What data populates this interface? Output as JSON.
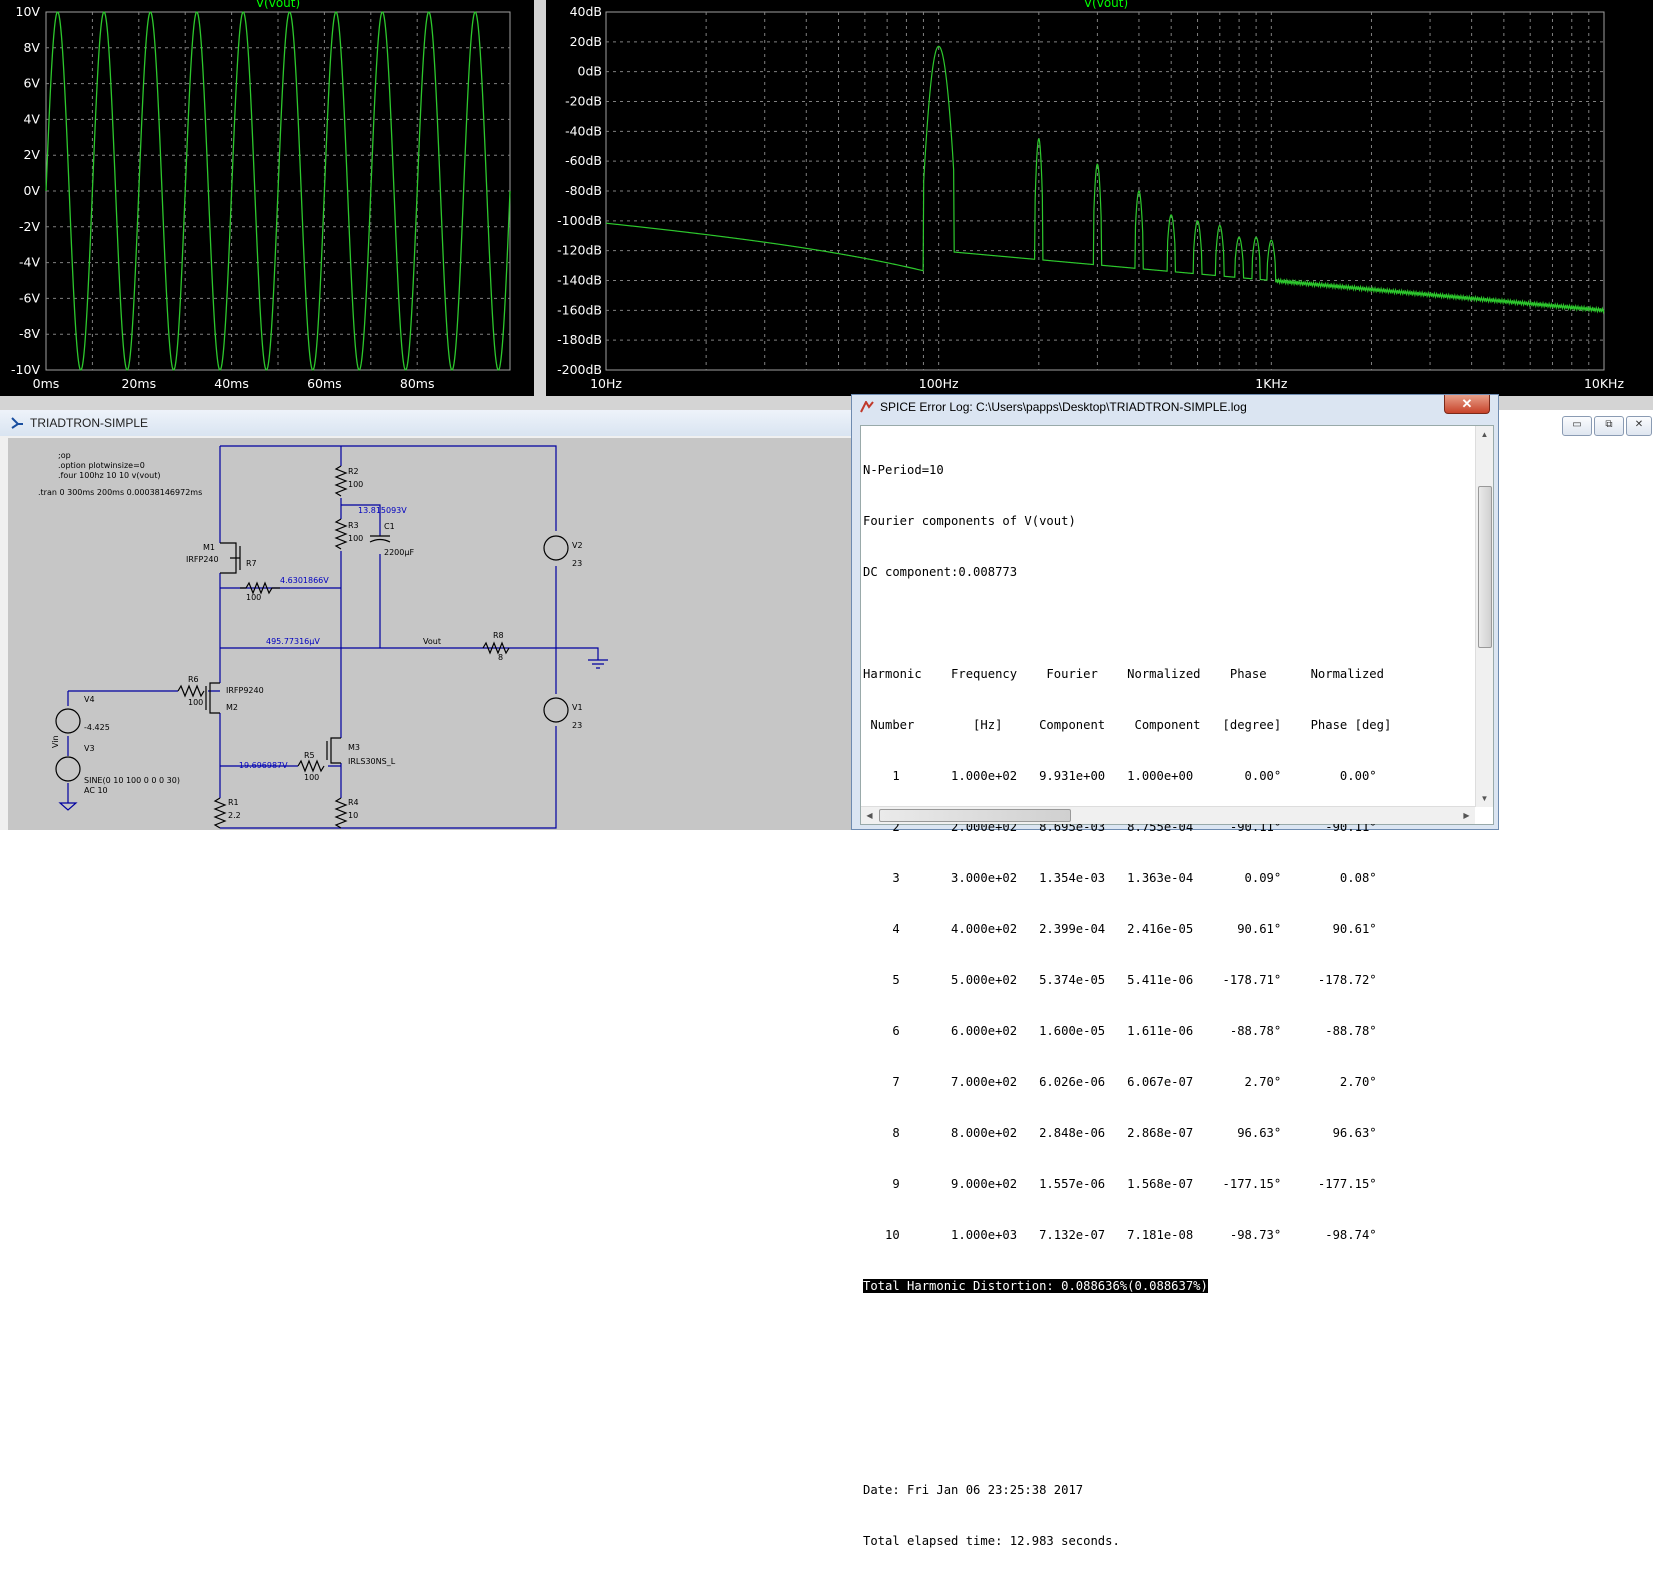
{
  "transient_plot": {
    "title": "V(vout)",
    "y_ticks": [
      "10V",
      "8V",
      "6V",
      "4V",
      "2V",
      "0V",
      "-2V",
      "-4V",
      "-6V",
      "-8V",
      "-10V"
    ],
    "x_ticks": [
      "0ms",
      "20ms",
      "40ms",
      "60ms",
      "80ms"
    ],
    "trace_color": "#2dc82d",
    "grid": true,
    "chart_data": {
      "type": "line",
      "series": [
        {
          "name": "V(vout)",
          "frequency_hz": 100,
          "amplitude_v": 10
        }
      ],
      "xlim": [
        0,
        100
      ],
      "ylim": [
        -10,
        10
      ]
    }
  },
  "fft_plot": {
    "title": "V(vout)",
    "y_ticks": [
      "40dB",
      "20dB",
      "0dB",
      "-20dB",
      "-40dB",
      "-60dB",
      "-80dB",
      "-100dB",
      "-120dB",
      "-140dB",
      "-160dB",
      "-180dB",
      "-200dB"
    ],
    "x_ticks": [
      "10Hz",
      "100Hz",
      "1KHz",
      "10KHz"
    ],
    "x_scale": "log",
    "chart_data": {
      "type": "line",
      "x_hz": [
        10,
        90,
        100,
        110,
        200,
        300,
        400,
        500,
        600,
        700,
        800,
        900,
        1000,
        10000
      ],
      "y_db": [
        -100,
        -118,
        17,
        -118,
        -45,
        -62,
        -80,
        -96,
        -100,
        -103,
        -111,
        -111,
        -113,
        -160
      ],
      "ylim": [
        -200,
        40
      ],
      "xlim": [
        10,
        10000
      ]
    }
  },
  "schematic": {
    "window_title": "TRIADTRON-SIMPLE",
    "directives": [
      ";op",
      ".option plotwinsize=0",
      ".four 100hz 10 10 v(vout)"
    ],
    "tran": ".tran 0 300ms 200ms 0.00038146972ms",
    "labels": {
      "r2": "R2",
      "r2v": "100",
      "r3": "R3",
      "r3v": "100",
      "node1": "13.815093V",
      "c1": "C1",
      "c1v": "2200µF",
      "m1": "M1",
      "m1v": "IRFP240",
      "r7": "R7",
      "r7v": "100",
      "node2": "4.6301866V",
      "v2": "V2",
      "v2v": "23",
      "node3": "495.77316µV",
      "vout": "Vout",
      "r8": "R8",
      "r8v": "8",
      "r6": "R6",
      "r6v": "100",
      "m2v": "IRFP9240",
      "m2": "M2",
      "v4": "V4",
      "v4v": "-4.425",
      "vin": "Vin",
      "v3": "V3",
      "v3v": "SINE(0 10 100 0 0 0 30)",
      "v3ac": "AC 10",
      "v1": "V1",
      "v1v": "23",
      "node4": "-19.696987V",
      "r5": "R5",
      "r5v": "100",
      "m3": "M3",
      "m3v": "IRLS30NS_L",
      "r1": "R1",
      "r1v": "2.2",
      "r4": "R4",
      "r4v": "10"
    }
  },
  "window_controls": {
    "minimize": "▭",
    "restore": "⧉",
    "close": "✕"
  },
  "error_log": {
    "title": "SPICE Error Log: C:\\Users\\papps\\Desktop\\TRIADTRON-SIMPLE.log",
    "close": "✕",
    "header_lines": [
      "N-Period=10",
      "Fourier components of V(vout)",
      "DC component:0.008773"
    ],
    "table_header1": "Harmonic    Frequency    Fourier    Normalized    Phase      Normalized",
    "table_header2": " Number        [Hz]     Component    Component   [degree]    Phase [deg]",
    "rows": [
      "    1       1.000e+02   9.931e+00   1.000e+00       0.00°        0.00°",
      "    2       2.000e+02   8.695e-03   8.755e-04     -90.11°      -90.11°",
      "    3       3.000e+02   1.354e-03   1.363e-04       0.09°        0.08°",
      "    4       4.000e+02   2.399e-04   2.416e-05      90.61°       90.61°",
      "    5       5.000e+02   5.374e-05   5.411e-06    -178.71°     -178.72°",
      "    6       6.000e+02   1.600e-05   1.611e-06     -88.78°      -88.78°",
      "    7       7.000e+02   6.026e-06   6.067e-07       2.70°        2.70°",
      "    8       8.000e+02   2.848e-06   2.868e-07      96.63°       96.63°",
      "    9       9.000e+02   1.557e-06   1.568e-07    -177.15°     -177.15°",
      "   10       1.000e+03   7.132e-07   7.181e-08     -98.73°      -98.74°"
    ],
    "thd": "Total Harmonic Distortion: 0.088636%(0.088637%)",
    "date": "Date: Fri Jan 06 23:25:38 2017",
    "elapsed": "Total elapsed time: 12.983 seconds."
  }
}
